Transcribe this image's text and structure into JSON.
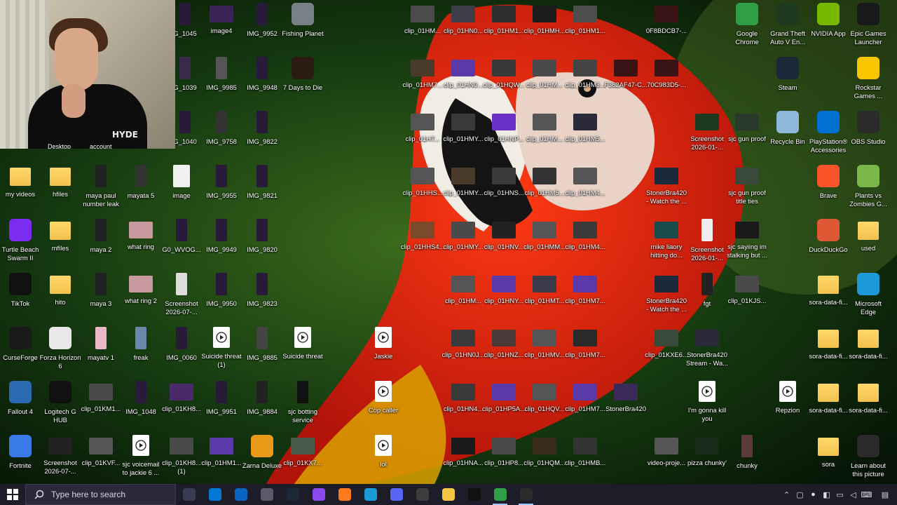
{
  "colors": {
    "taskbar": "#1d1d2a",
    "search_box": "#2a2a3c",
    "folder": "#f2c14e",
    "parrot_red": "#e0200e"
  },
  "taskbar": {
    "start_icon": "windows-logo-icon",
    "search_placeholder": "Type here to search",
    "pinned_apps": [
      {
        "name": "task-view",
        "color": "#3a3a52"
      },
      {
        "name": "microsoft-store",
        "color": "#0078d4"
      },
      {
        "name": "outlook",
        "color": "#0a64c2"
      },
      {
        "name": "settings",
        "color": "#5a5a6a"
      },
      {
        "name": "steam",
        "color": "#1b2838"
      },
      {
        "name": "twitch",
        "color": "#8d49f0"
      },
      {
        "name": "firefox",
        "color": "#ff7a1a"
      },
      {
        "name": "edge",
        "color": "#1a9ad6"
      },
      {
        "name": "discord",
        "color": "#5865f2"
      },
      {
        "name": "obs",
        "color": "#3d3d3d"
      },
      {
        "name": "file-explorer",
        "color": "#f4c542"
      },
      {
        "name": "tiktok",
        "color": "#111111"
      },
      {
        "name": "chrome",
        "color": "#2f9e44"
      },
      {
        "name": "obs-studio-2",
        "color": "#2b2b2b"
      }
    ]
  },
  "webcam": {
    "left_label": "Desktop",
    "right_label": "account",
    "shirt_text": "HYDE"
  },
  "icons": [
    {
      "label": "G_1045",
      "kind": "phone",
      "color": "#2a1a3a"
    },
    {
      "label": "image4",
      "kind": "wide",
      "color": "#3a2458"
    },
    {
      "label": "IMG_9952",
      "kind": "phone",
      "color": "#2a1a3a"
    },
    {
      "label": "Fishing Planet",
      "kind": "app",
      "color": "#7a8088"
    },
    {
      "label": "clip_01HM...",
      "kind": "wide",
      "color": "#4b4b4b"
    },
    {
      "label": "clip_01HN0...",
      "kind": "wide",
      "color": "#3d3d48"
    },
    {
      "label": "clip_01HM1...",
      "kind": "wide",
      "color": "#2e2e2e"
    },
    {
      "label": "clip_01HMH...",
      "kind": "wide",
      "color": "#1c1c1c"
    },
    {
      "label": "clip_01HM1...",
      "kind": "wide",
      "color": "#4e4e4e"
    },
    {
      "label": "0F8BDCB7-...",
      "kind": "wide",
      "color": "#3a1414"
    },
    {
      "label": "Google\nChrome",
      "kind": "app",
      "color": "#2f9e44"
    },
    {
      "label": "Grand Theft\nAuto V En...",
      "kind": "app",
      "color": "#1e3a1e"
    },
    {
      "label": "NVIDIA App",
      "kind": "app",
      "color": "#76b900"
    },
    {
      "label": "Epic Games\nLauncher",
      "kind": "app",
      "color": "#1a1a1a"
    },
    {
      "label": "G_1039",
      "kind": "phone",
      "color": "#3a2a4a"
    },
    {
      "label": "IMG_9985",
      "kind": "phone",
      "color": "#555"
    },
    {
      "label": "IMG_9948",
      "kind": "phone",
      "color": "#2a1a3a"
    },
    {
      "label": "7 Days to Die",
      "kind": "app",
      "color": "#2b1b12"
    },
    {
      "label": "clip_01HM7...",
      "kind": "wide",
      "color": "#4a3a2a"
    },
    {
      "label": "clip_01HN0...",
      "kind": "wide",
      "color": "#5a3aa8"
    },
    {
      "label": "clip_01HQW...",
      "kind": "wide",
      "color": "#383838"
    },
    {
      "label": "clip_01HM...",
      "kind": "wide",
      "color": "#4a4a4a"
    },
    {
      "label": "clip_01HM3...",
      "kind": "wide",
      "color": "#444"
    },
    {
      "label": "F362AF47-C...",
      "kind": "wide",
      "color": "#3a1414"
    },
    {
      "label": "70C983D5-...",
      "kind": "wide",
      "color": "#3a1414"
    },
    {
      "label": "Steam",
      "kind": "app",
      "color": "#1b2838"
    },
    {
      "label": "Rockstar\nGames ...",
      "kind": "app",
      "color": "#f7c600"
    },
    {
      "label": "G_1040",
      "kind": "phone",
      "color": "#2a1a3a"
    },
    {
      "label": "IMG_9758",
      "kind": "phone",
      "color": "#333"
    },
    {
      "label": "IMG_9822",
      "kind": "phone",
      "color": "#2a1a3a"
    },
    {
      "label": "clip_01HT...",
      "kind": "wide",
      "color": "#555"
    },
    {
      "label": "clip_01HMY...",
      "kind": "wide",
      "color": "#3a3a3a"
    },
    {
      "label": "clip_01HNP...",
      "kind": "wide",
      "color": "#6a30c8"
    },
    {
      "label": "clip_01HM...",
      "kind": "wide",
      "color": "#555"
    },
    {
      "label": "clip_01HM5...",
      "kind": "wide",
      "color": "#2a2a3a"
    },
    {
      "label": "Screenshot\n2026-01-...",
      "kind": "wide",
      "color": "#1e3a1e"
    },
    {
      "label": "sjc gun proof",
      "kind": "wide",
      "color": "#2a3a2a"
    },
    {
      "label": "Recycle Bin",
      "kind": "app",
      "color": "#8fb8d8"
    },
    {
      "label": "PlayStation®\nAccessories",
      "kind": "app",
      "color": "#0070d1"
    },
    {
      "label": "OBS Studio",
      "kind": "app",
      "color": "#2b2b2b"
    },
    {
      "label": "my videos",
      "kind": "folder",
      "color": "#f2c14e"
    },
    {
      "label": "hfiles",
      "kind": "folder",
      "color": "#f2c14e"
    },
    {
      "label": "maya paul\nnumber leak",
      "kind": "phone",
      "color": "#222"
    },
    {
      "label": "mayata 5",
      "kind": "phone",
      "color": "#333"
    },
    {
      "label": "image",
      "kind": "doc",
      "color": "#f0f0f0"
    },
    {
      "label": "IMG_9955",
      "kind": "phone",
      "color": "#2a1a3a"
    },
    {
      "label": "IMG_9821",
      "kind": "phone",
      "color": "#2a1a3a"
    },
    {
      "label": "clip_01HHS...",
      "kind": "wide",
      "color": "#555"
    },
    {
      "label": "clip_01HMY...",
      "kind": "wide",
      "color": "#4a3a2a"
    },
    {
      "label": "clip_01HNS...",
      "kind": "wide",
      "color": "#3a3a3a"
    },
    {
      "label": "clip_01HM5...",
      "kind": "wide",
      "color": "#333"
    },
    {
      "label": "clip_01HM4...",
      "kind": "wide",
      "color": "#555"
    },
    {
      "label": "StonerBra420\n- Watch the ...",
      "kind": "wide",
      "color": "#1a2a3a"
    },
    {
      "label": "sjc gun proof\ntitle ties",
      "kind": "wide",
      "color": "#3a4a3a"
    },
    {
      "label": "Brave",
      "kind": "app",
      "color": "#fb542b"
    },
    {
      "label": "Plants vs\nZombies G...",
      "kind": "app",
      "color": "#7ab648"
    },
    {
      "label": "Turtle Beach\nSwarm II",
      "kind": "app",
      "color": "#7b2cf0"
    },
    {
      "label": "mfiles",
      "kind": "folder",
      "color": "#f2c14e"
    },
    {
      "label": "maya 2",
      "kind": "phone",
      "color": "#222"
    },
    {
      "label": "what ring",
      "kind": "wide",
      "color": "#c89aa0"
    },
    {
      "label": "G0_WVOG...",
      "kind": "phone",
      "color": "#2a1a3a"
    },
    {
      "label": "IMG_9949",
      "kind": "phone",
      "color": "#2a1a3a"
    },
    {
      "label": "IMG_9820",
      "kind": "phone",
      "color": "#2a1a3a"
    },
    {
      "label": "clip_01HHS4...",
      "kind": "wide",
      "color": "#7a4a2a"
    },
    {
      "label": "clip_01HMY...",
      "kind": "wide",
      "color": "#4a4a4a"
    },
    {
      "label": "clip_01HNV...",
      "kind": "wide",
      "color": "#222"
    },
    {
      "label": "clip_01HMM...",
      "kind": "wide",
      "color": "#555"
    },
    {
      "label": "clip_01HM4...",
      "kind": "wide",
      "color": "#3a3a3a"
    },
    {
      "label": "mike liaory\nhitting do...",
      "kind": "wide",
      "color": "#1a4a4a"
    },
    {
      "label": "Screenshot\n2026-01-...",
      "kind": "phone",
      "color": "#eee"
    },
    {
      "label": "sjc sayiing im\nstalking but ...",
      "kind": "wide",
      "color": "#1a1a1a"
    },
    {
      "label": "DuckDuckGo",
      "kind": "app",
      "color": "#de5833"
    },
    {
      "label": "used",
      "kind": "folder",
      "color": "#f2c14e"
    },
    {
      "label": "TikTok",
      "kind": "app",
      "color": "#111"
    },
    {
      "label": "hito",
      "kind": "folder",
      "color": "#f2c14e"
    },
    {
      "label": "maya 3",
      "kind": "phone",
      "color": "#222"
    },
    {
      "label": "what ring 2",
      "kind": "wide",
      "color": "#c89aa0"
    },
    {
      "label": "Screenshot\n2026-07-...",
      "kind": "phone",
      "color": "#ddd"
    },
    {
      "label": "IMG_9950",
      "kind": "phone",
      "color": "#2a1a3a"
    },
    {
      "label": "IMG_9823",
      "kind": "phone",
      "color": "#2a1a3a"
    },
    {
      "label": "clip_01HM...",
      "kind": "wide",
      "color": "#555"
    },
    {
      "label": "clip_01HNY...",
      "kind": "wide",
      "color": "#5a3aa8"
    },
    {
      "label": "clip_01HMT...",
      "kind": "wide",
      "color": "#3a3a4a"
    },
    {
      "label": "clip_01HM7...",
      "kind": "wide",
      "color": "#5a3aa8"
    },
    {
      "label": "StonerBra420\n- Watch the ...",
      "kind": "wide",
      "color": "#1a2a3a"
    },
    {
      "label": "fgt",
      "kind": "phone",
      "color": "#222"
    },
    {
      "label": "clip_01KJS...",
      "kind": "wide",
      "color": "#4a4a4a"
    },
    {
      "label": "sora-data-fi...",
      "kind": "folder",
      "color": "#f2c14e"
    },
    {
      "label": "Microsoft\nEdge",
      "kind": "app",
      "color": "#1a9ad6"
    },
    {
      "label": "CurseForge",
      "kind": "app",
      "color": "#1a1a1a"
    },
    {
      "label": "Forza Horizon\n6",
      "kind": "app",
      "color": "#e8e8e8"
    },
    {
      "label": "mayatv 1",
      "kind": "phone",
      "color": "#e8b8c8"
    },
    {
      "label": "freak",
      "kind": "phone",
      "color": "#6a88aa"
    },
    {
      "label": "IMG_0060",
      "kind": "phone",
      "color": "#2a1a3a"
    },
    {
      "label": "Suicide threat\n(1)",
      "kind": "video",
      "color": "#ffffff"
    },
    {
      "label": "IMG_9885",
      "kind": "phone",
      "color": "#444"
    },
    {
      "label": "Suicide threat",
      "kind": "video",
      "color": "#ffffff"
    },
    {
      "label": "Jaskie",
      "kind": "video",
      "color": "#ffffff"
    },
    {
      "label": "clip_01HN0J...",
      "kind": "wide",
      "color": "#3a3a3a"
    },
    {
      "label": "clip_01HNZ...",
      "kind": "wide",
      "color": "#4a3a3a"
    },
    {
      "label": "clip_01HMV...",
      "kind": "wide",
      "color": "#555"
    },
    {
      "label": "clip_01HM7...",
      "kind": "wide",
      "color": "#2a2a2a"
    },
    {
      "label": "clip_01KXE6...",
      "kind": "wide",
      "color": "#3a4a3a"
    },
    {
      "label": "StonerBra420\nStream - Wa...",
      "kind": "wide",
      "color": "#2a2a3a"
    },
    {
      "label": "sora-data-fi...",
      "kind": "folder",
      "color": "#f2c14e"
    },
    {
      "label": "sora-data-fi...",
      "kind": "folder",
      "color": "#f2c14e"
    },
    {
      "label": "Fallout 4",
      "kind": "app",
      "color": "#2a6ab0"
    },
    {
      "label": "Logitech G\nHUB",
      "kind": "app",
      "color": "#111"
    },
    {
      "label": "clip_01KM1...",
      "kind": "wide",
      "color": "#4a4a4a"
    },
    {
      "label": "IMG_1048",
      "kind": "phone",
      "color": "#2a1a3a"
    },
    {
      "label": "clip_01KH8...",
      "kind": "wide",
      "color": "#4a2a6a"
    },
    {
      "label": "IMG_9951",
      "kind": "phone",
      "color": "#2a1a3a"
    },
    {
      "label": "IMG_9884",
      "kind": "phone",
      "color": "#222"
    },
    {
      "label": "sjc botting\nservice",
      "kind": "phone",
      "color": "#111"
    },
    {
      "label": "Cop caller",
      "kind": "video",
      "color": "#ffffff"
    },
    {
      "label": "clip_01HN4...",
      "kind": "wide",
      "color": "#3a3a3a"
    },
    {
      "label": "clip_01HP5A...",
      "kind": "wide",
      "color": "#5a3aa8"
    },
    {
      "label": "clip_01HQV...",
      "kind": "wide",
      "color": "#555"
    },
    {
      "label": "clip_01HM7...",
      "kind": "wide",
      "color": "#5a3aa8"
    },
    {
      "label": "StonerBra420",
      "kind": "wide",
      "color": "#3a2a5a"
    },
    {
      "label": "I'm gonna kill\nyou",
      "kind": "video",
      "color": "#ffffff"
    },
    {
      "label": "Repzion",
      "kind": "video",
      "color": "#ffffff"
    },
    {
      "label": "sora-data-fi...",
      "kind": "folder",
      "color": "#f2c14e"
    },
    {
      "label": "sora-data-fi...",
      "kind": "folder",
      "color": "#f2c14e"
    },
    {
      "label": "Fortnite",
      "kind": "app",
      "color": "#3a7ae8"
    },
    {
      "label": "Screenshot\n2026-07-...",
      "kind": "wide",
      "color": "#222"
    },
    {
      "label": "clip_01KVF...",
      "kind": "wide",
      "color": "#555"
    },
    {
      "label": "sjc voicemail\nto jackie 6 ...",
      "kind": "video",
      "color": "#ffffff"
    },
    {
      "label": "clip_01KH8...\n(1)",
      "kind": "wide",
      "color": "#4a4a4a"
    },
    {
      "label": "clip_01HM1...",
      "kind": "wide",
      "color": "#5a3aa8"
    },
    {
      "label": "Zarna Deluxe",
      "kind": "app",
      "color": "#e89a18"
    },
    {
      "label": "clip_01KX7...",
      "kind": "wide",
      "color": "#4a5a4a"
    },
    {
      "label": "lol",
      "kind": "video",
      "color": "#ffffff"
    },
    {
      "label": "clip_01HNA...",
      "kind": "wide",
      "color": "#1a1a1a"
    },
    {
      "label": "clip_01HP8...",
      "kind": "wide",
      "color": "#4a4a4a"
    },
    {
      "label": "clip_01HQM...",
      "kind": "wide",
      "color": "#3a2a1a"
    },
    {
      "label": "clip_01HMB...",
      "kind": "wide",
      "color": "#333"
    },
    {
      "label": "video-proje...",
      "kind": "wide",
      "color": "#555"
    },
    {
      "label": "pizza chunky'",
      "kind": "wide",
      "color": "#1a2a1a"
    },
    {
      "label": "chunky",
      "kind": "phone",
      "color": "#5a3a3a"
    },
    {
      "label": "sora",
      "kind": "folder",
      "color": "#f2c14e"
    },
    {
      "label": "Learn about\nthis picture",
      "kind": "app",
      "color": "#2a2a2a"
    }
  ]
}
